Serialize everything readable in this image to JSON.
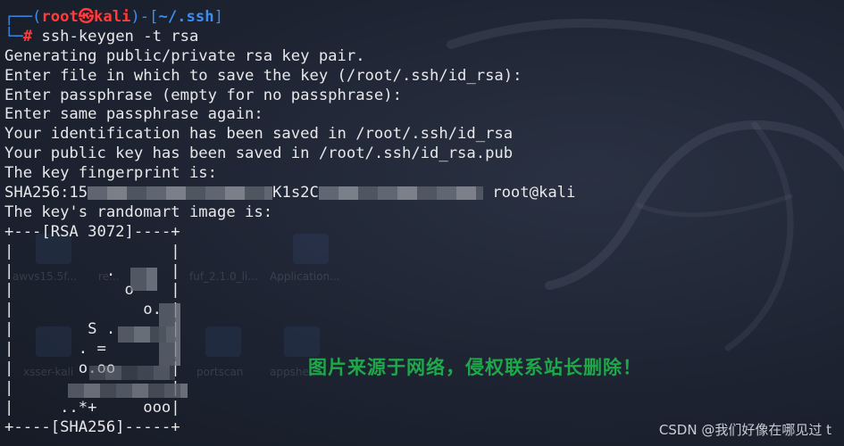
{
  "prompt": {
    "corner_top": "┌──(",
    "user": "root",
    "at_symbol": "㉿",
    "host": "kali",
    "mid": ")-[",
    "path": "~/.ssh",
    "end": "]",
    "corner_bottom": "└─",
    "hash": "#",
    "command": "ssh-keygen -t rsa"
  },
  "output": [
    "Generating public/private rsa key pair.",
    "Enter file in which to save the key (/root/.ssh/id_rsa):",
    "Enter passphrase (empty for no passphrase):",
    "Enter same passphrase again:",
    "Your identification has been saved in /root/.ssh/id_rsa",
    "Your public key has been saved in /root/.ssh/id_rsa.pub",
    "The key fingerprint is:"
  ],
  "fingerprint": {
    "prefix": "SHA256:15",
    "middle": "K1s2C",
    "suffix": " root@kali"
  },
  "randomart_intro": "The key's randomart image is:",
  "randomart": [
    "+---[RSA 3072]----+",
    "|                 |",
    "|          .      |",
    "|            o    |",
    "|              o. |",
    "|        S .      |",
    "|       . =       |",
    "|       o.oo      |",
    "|                 |",
    "|     ..*+     ooo|",
    "+----[SHA256]-----+"
  ],
  "watermark": "图片来源于网络，侵权联系站长删除！",
  "credit": "CSDN @我们好像在哪见过 t",
  "desktop_labels": [
    "awvs15.5f...",
    "re...",
    "fuf_2.1.0_li...",
    "Application...",
    "xsser-kali",
    "portscan",
    "appshell"
  ]
}
